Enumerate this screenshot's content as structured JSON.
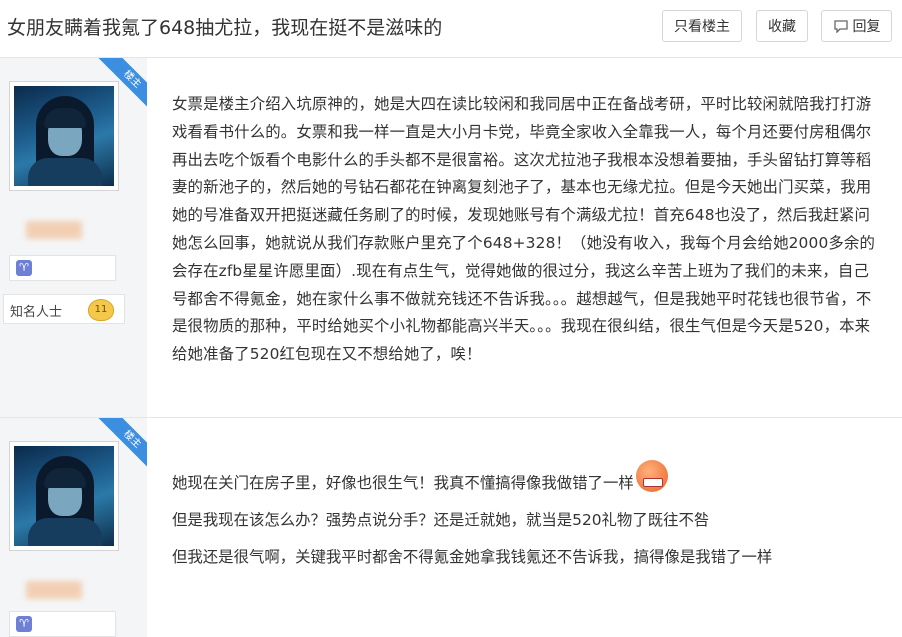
{
  "header": {
    "title": "女朋友瞒着我氪了648抽尤拉，我现在挺不是滋味的",
    "only_op_label": "只看楼主",
    "favorite_label": "收藏",
    "reply_label": "回复"
  },
  "posts": [
    {
      "op_tag": "楼主",
      "rank_title": "知名人士",
      "level": "11",
      "content": "女票是楼主介绍入坑原神的，她是大四在读比较闲和我同居中正在备战考研，平时比较闲就陪我打打游戏看看书什么的。女票和我一样一直是大小月卡党，毕竟全家收入全靠我一人，每个月还要付房租偶尔再出去吃个饭看个电影什么的手头都不是很富裕。这次尤拉池子我根本没想着要抽，手头留钻打算等稻妻的新池子的，然后她的号钻石都花在钟离复刻池子了，基本也无缘尤拉。但是今天她出门买菜，我用她的号准备双开把挺迷藏任务刷了的时候，发现她账号有个满级尤拉！首充648也没了，然后我赶紧问她怎么回事，她就说从我们存款账户里充了个648+328！（她没有收入，我每个月会给她2000多余的会存在zfb星星许愿里面）.现在有点生气，觉得她做的很过分，我这么辛苦上班为了我们的未来，自己号都舍不得氪金，她在家什么事不做就充钱还不告诉我。。。越想越气，但是我她平时花钱也很节省，不是很物质的那种，平时给她买个小礼物都能高兴半天。。。我现在很纠结，很生气但是今天是520，本来给她准备了520红包现在又不想给她了，唉！"
    },
    {
      "op_tag": "楼主",
      "lines": [
        "她现在关门在房子里，好像也很生气！我真不懂搞得像我做错了一样",
        "但是我现在该怎么办？强势点说分手？还是迁就她，就当是520礼物了既往不咎",
        "但我还是很气啊，关键我平时都舍不得氪金她拿我钱氪还不告诉我，搞得像是我错了一样"
      ]
    }
  ],
  "icons": [
    "reply-icon",
    "constellation-badge-icon",
    "angry-emoji-icon"
  ],
  "colors": {
    "accent_blue": "#3b8ee0",
    "sidebar_bg": "#f4f5f7",
    "level_gold": "#f4c84b"
  }
}
